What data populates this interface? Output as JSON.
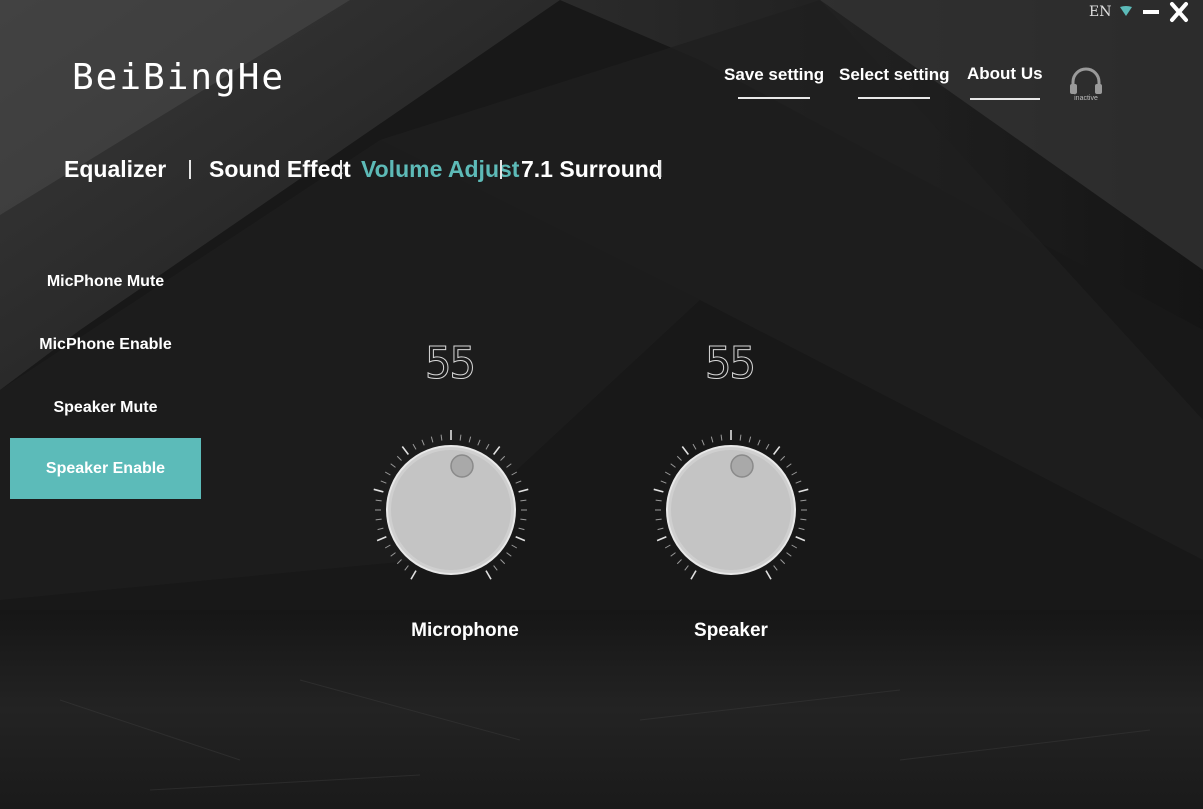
{
  "window": {
    "language": "EN",
    "icons": {
      "language_caret": "caret-down-icon",
      "minimize": "minimize-icon",
      "close": "close-icon"
    }
  },
  "brand": {
    "name": "BeiBingHe"
  },
  "header_nav": {
    "save_label": "Save setting",
    "select_label": "Select setting",
    "about_label": "About Us"
  },
  "device_status": {
    "label": "inactive",
    "icon": "headset-icon"
  },
  "tabs": [
    {
      "label": "Equalizer",
      "active": false
    },
    {
      "label": "Sound Effect",
      "active": false
    },
    {
      "label": "Volume Adjust",
      "active": true
    },
    {
      "label": "7.1 Surround",
      "active": false
    }
  ],
  "sidebar": {
    "items": [
      {
        "label": "MicPhone Mute",
        "active": false
      },
      {
        "label": "MicPhone Enable",
        "active": false
      },
      {
        "label": "Speaker Mute",
        "active": false
      },
      {
        "label": "Speaker Enable",
        "active": true
      }
    ]
  },
  "volume": {
    "microphone": {
      "label": "Microphone",
      "value": "55"
    },
    "speaker": {
      "label": "Speaker",
      "value": "55"
    }
  },
  "colors": {
    "accent": "#5cbbb9",
    "text": "#ffffff",
    "background": "#141414"
  }
}
